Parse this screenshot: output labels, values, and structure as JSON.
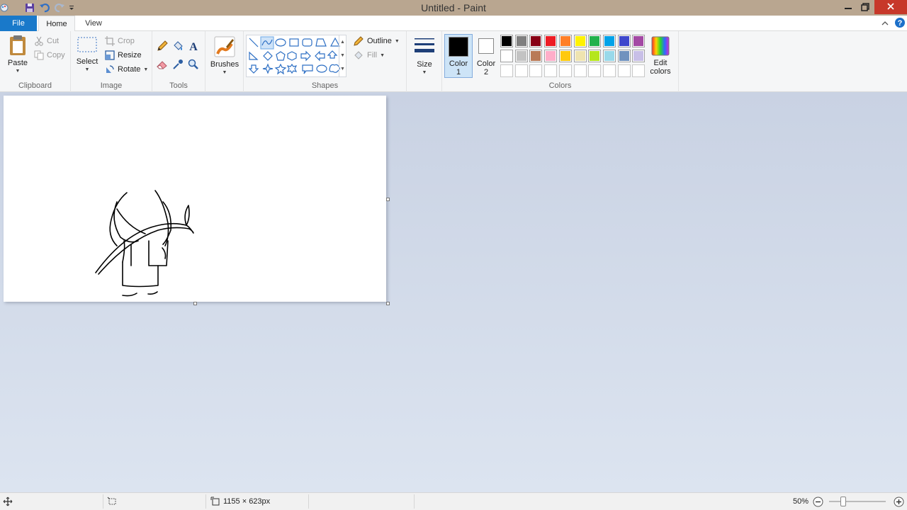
{
  "window": {
    "title": "Untitled - Paint"
  },
  "tabs": {
    "file": "File",
    "home": "Home",
    "view": "View"
  },
  "clipboard": {
    "paste": "Paste",
    "cut": "Cut",
    "copy": "Copy",
    "label": "Clipboard"
  },
  "image": {
    "select": "Select",
    "crop": "Crop",
    "resize": "Resize",
    "rotate": "Rotate",
    "label": "Image"
  },
  "tools": {
    "label": "Tools"
  },
  "brushes": {
    "label": "Brushes"
  },
  "shapes": {
    "outline": "Outline",
    "fill": "Fill",
    "label": "Shapes"
  },
  "size": {
    "label": "Size"
  },
  "colors": {
    "color1_line1": "Color",
    "color1_line2": "1",
    "color2_line1": "Color",
    "color2_line2": "2",
    "edit_line1": "Edit",
    "edit_line2": "colors",
    "label": "Colors",
    "color1": "#000000",
    "color2": "#ffffff",
    "palette_row1": [
      "#000000",
      "#7f7f7f",
      "#880015",
      "#ed1c24",
      "#ff7f27",
      "#fff200",
      "#22b14c",
      "#00a2e8",
      "#3f48cc",
      "#a349a4"
    ],
    "palette_row2": [
      "#ffffff",
      "#c3c3c3",
      "#b97a57",
      "#ffaec9",
      "#ffc90e",
      "#efe4b0",
      "#b5e61d",
      "#99d9ea",
      "#7092be",
      "#c8bfe7"
    ]
  },
  "status": {
    "dimensions": "1155 × 623px",
    "zoom": "50%"
  }
}
